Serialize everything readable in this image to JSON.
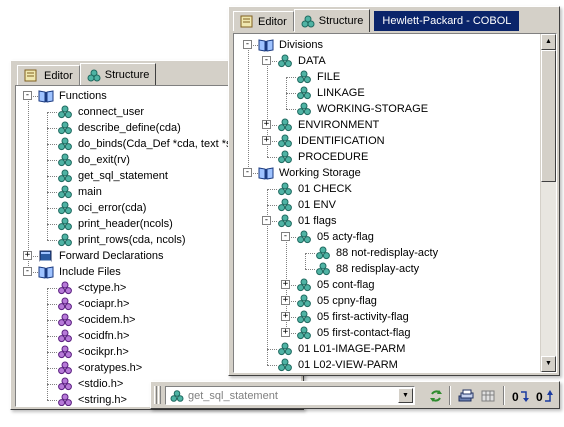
{
  "left_panel": {
    "tabs": [
      {
        "label": "Editor",
        "icon": "editor-tab-icon"
      },
      {
        "label": "Structure",
        "icon": "structure-tab-icon"
      }
    ],
    "tree": [
      {
        "label": "Functions",
        "icon": "book-icon",
        "level": 0,
        "expander": "-"
      },
      {
        "label": "connect_user",
        "icon": "function-icon",
        "level": 1
      },
      {
        "label": "describe_define(cda)",
        "icon": "function-icon",
        "level": 1
      },
      {
        "label": "do_binds(Cda_Def *cda, text *stu",
        "icon": "function-icon",
        "level": 1
      },
      {
        "label": "do_exit(rv)",
        "icon": "function-icon",
        "level": 1
      },
      {
        "label": "get_sql_statement",
        "icon": "function-icon",
        "level": 1
      },
      {
        "label": "main",
        "icon": "function-icon",
        "level": 1
      },
      {
        "label": "oci_error(cda)",
        "icon": "function-icon",
        "level": 1
      },
      {
        "label": "print_header(ncols)",
        "icon": "function-icon",
        "level": 1
      },
      {
        "label": "print_rows(cda, ncols)",
        "icon": "function-icon",
        "level": 1
      },
      {
        "label": "Forward Declarations",
        "icon": "closed-book-icon",
        "level": 0,
        "expander": "+"
      },
      {
        "label": "Include Files",
        "icon": "book-icon",
        "level": 0,
        "expander": "-"
      },
      {
        "label": "<ctype.h>",
        "icon": "include-icon",
        "level": 1
      },
      {
        "label": "<ociapr.h>",
        "icon": "include-icon",
        "level": 1
      },
      {
        "label": "<ocidem.h>",
        "icon": "include-icon",
        "level": 1
      },
      {
        "label": "<ocidfn.h>",
        "icon": "include-icon",
        "level": 1
      },
      {
        "label": "<ocikpr.h>",
        "icon": "include-icon",
        "level": 1
      },
      {
        "label": "<oratypes.h>",
        "icon": "include-icon",
        "level": 1
      },
      {
        "label": "<stdio.h>",
        "icon": "include-icon",
        "level": 1
      },
      {
        "label": "<string.h>",
        "icon": "include-icon",
        "level": 1
      }
    ]
  },
  "right_panel": {
    "tabs": [
      {
        "label": "Editor",
        "icon": "editor-tab-icon"
      },
      {
        "label": "Structure",
        "icon": "structure-tab-icon"
      }
    ],
    "title": "Hewlett-Packard - COBOL",
    "tree": [
      {
        "label": "Divisions",
        "icon": "book-icon",
        "level": 0,
        "expander": "-"
      },
      {
        "label": "DATA",
        "icon": "structure-node-icon",
        "level": 1,
        "expander": "-"
      },
      {
        "label": "FILE",
        "icon": "structure-node-icon",
        "level": 2
      },
      {
        "label": "LINKAGE",
        "icon": "structure-node-icon",
        "level": 2
      },
      {
        "label": "WORKING-STORAGE",
        "icon": "structure-node-icon",
        "level": 2
      },
      {
        "label": "ENVIRONMENT",
        "icon": "structure-node-icon",
        "level": 1,
        "expander": "+"
      },
      {
        "label": "IDENTIFICATION",
        "icon": "structure-node-icon",
        "level": 1,
        "expander": "+"
      },
      {
        "label": "PROCEDURE",
        "icon": "structure-node-icon",
        "level": 1
      },
      {
        "label": "Working Storage",
        "icon": "book-icon",
        "level": 0,
        "expander": "-"
      },
      {
        "label": "01 CHECK",
        "icon": "structure-node-icon",
        "level": 1
      },
      {
        "label": "01 ENV",
        "icon": "structure-node-icon",
        "level": 1
      },
      {
        "label": "01 flags",
        "icon": "structure-node-icon",
        "level": 1,
        "expander": "-"
      },
      {
        "label": "05 acty-flag",
        "icon": "structure-node-icon",
        "level": 2,
        "expander": "-"
      },
      {
        "label": "88 not-redisplay-acty",
        "icon": "structure-node-icon",
        "level": 3
      },
      {
        "label": "88 redisplay-acty",
        "icon": "structure-node-icon",
        "level": 3
      },
      {
        "label": "05 cont-flag",
        "icon": "structure-node-icon",
        "level": 2,
        "expander": "+"
      },
      {
        "label": "05 cpny-flag",
        "icon": "structure-node-icon",
        "level": 2,
        "expander": "+"
      },
      {
        "label": "05 first-activity-flag",
        "icon": "structure-node-icon",
        "level": 2,
        "expander": "+"
      },
      {
        "label": "05 first-contact-flag",
        "icon": "structure-node-icon",
        "level": 2,
        "expander": "+"
      },
      {
        "label": "01 L01-IMAGE-PARM",
        "icon": "structure-node-icon",
        "level": 1
      },
      {
        "label": "01 L02-VIEW-PARM",
        "icon": "structure-node-icon",
        "level": 1
      }
    ]
  },
  "toolbar": {
    "combo_value": "get_sql_statement",
    "buttons": [
      {
        "name": "refresh-button",
        "icon": "refresh-icon"
      },
      {
        "name": "stack-button",
        "icon": "stack-icon"
      },
      {
        "name": "grid-button",
        "icon": "grid-icon"
      },
      {
        "name": "step-in-button",
        "icon": "step-in-icon"
      },
      {
        "name": "step-out-button",
        "icon": "step-out-icon"
      }
    ]
  },
  "colors": {
    "panel": "#d4d0c8",
    "title_bar": "#0a246a",
    "function_icon": "#2b8a78",
    "include_icon": "#8a3ab8",
    "book_icon": "#2a5aa0"
  }
}
